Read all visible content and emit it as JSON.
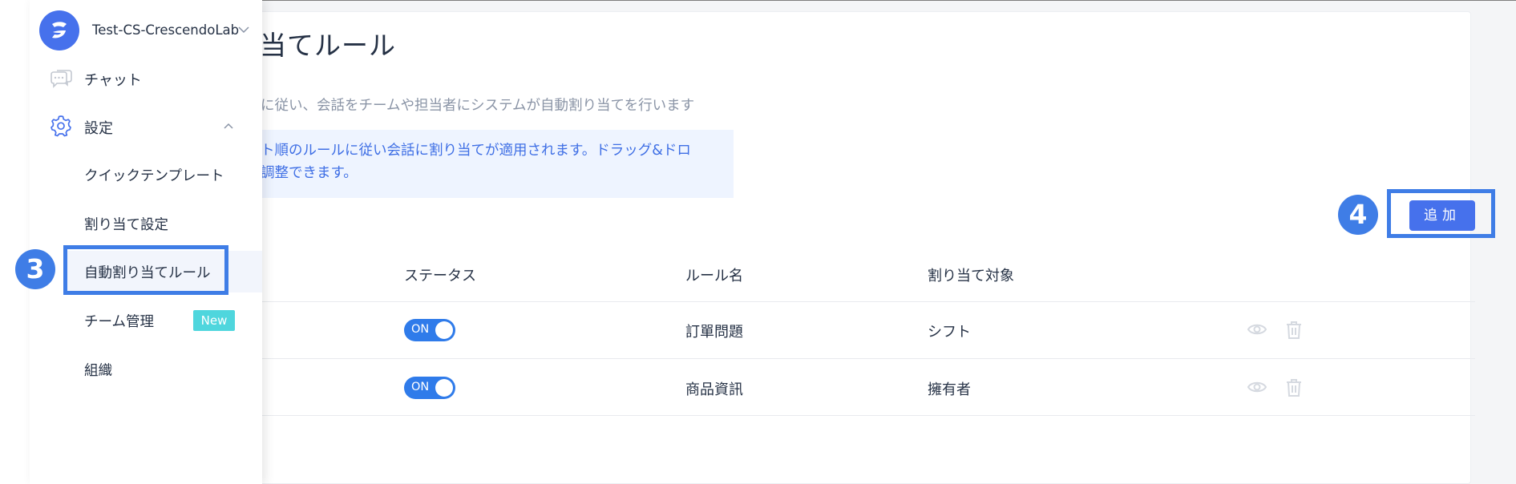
{
  "page": {
    "title": "て当てルール",
    "description": "ールに従い、会話をチームや担当者にシステムが自動割り当てを行います",
    "info_line1": "リスト順のルールに従い会話に割り当てが適用されます。ドラッグ&ドロ",
    "info_line2": "位を調整できます。",
    "add_button_label": "追加"
  },
  "badges": {
    "step3": "3",
    "step4": "4"
  },
  "table": {
    "headers": [
      "ステータス",
      "ルール名",
      "割り当て対象"
    ],
    "rows": [
      {
        "status": "ON",
        "rule_name": "訂單問題",
        "target": "シフト"
      },
      {
        "status": "ON",
        "rule_name": "商品資訊",
        "target": "擁有者"
      }
    ]
  },
  "sidebar": {
    "org_name": "Test-CS-CrescendoLab",
    "chat_label": "チャット",
    "settings_label": "設定",
    "sub_items": [
      {
        "label": "クイックテンプレート"
      },
      {
        "label": "割り当て設定"
      },
      {
        "label": "自動割り当てルール"
      },
      {
        "label": "チーム管理",
        "tag": "New"
      },
      {
        "label": "組織"
      }
    ]
  },
  "colors": {
    "accent": "#4671ec",
    "highlight": "#3f7de6",
    "toggle_on": "#2f7bea",
    "new_tag": "#4fd6dd",
    "text": "#253145",
    "muted": "#8a94a6"
  },
  "icons": [
    "chat-icon",
    "gear-icon",
    "chevron-up-icon",
    "chevron-down-icon",
    "eye-icon",
    "trash-icon",
    "logo-icon"
  ]
}
